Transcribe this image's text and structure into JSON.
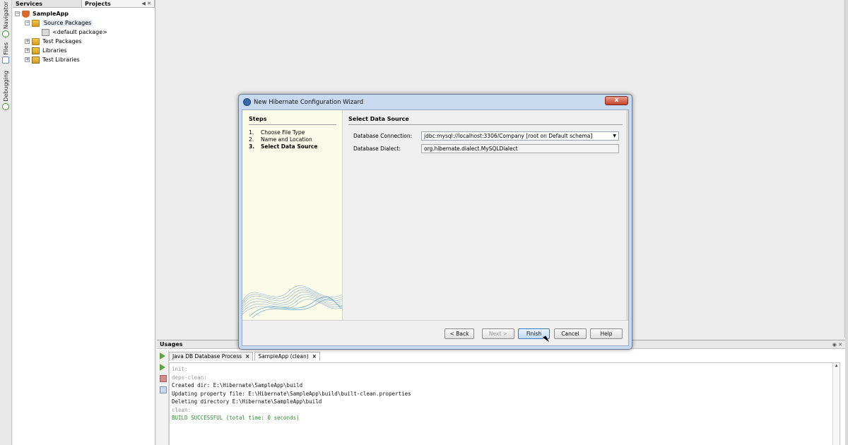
{
  "left_strip": {
    "tabs": [
      "Navigator",
      "Files",
      "Debugging"
    ]
  },
  "projects_panel": {
    "tabs": [
      "Services",
      "Projects"
    ],
    "tree": [
      {
        "label": "SampleApp",
        "level": 0,
        "toggle": "−",
        "bold": true,
        "icon": "project-icon"
      },
      {
        "label": "Source Packages",
        "level": 1,
        "toggle": "−",
        "icon": "source-packages-icon",
        "selected": true
      },
      {
        "label": "<default package>",
        "level": 2,
        "toggle": "",
        "icon": "package-icon"
      },
      {
        "label": "Test Packages",
        "level": 1,
        "toggle": "+",
        "icon": "test-packages-icon"
      },
      {
        "label": "Libraries",
        "level": 1,
        "toggle": "+",
        "icon": "libraries-icon"
      },
      {
        "label": "Test Libraries",
        "level": 1,
        "toggle": "+",
        "icon": "test-libraries-icon"
      }
    ]
  },
  "dialog": {
    "title": "New Hibernate Configuration Wizard",
    "close": "x",
    "steps_title": "Steps",
    "steps": [
      {
        "num": "1.",
        "label": "Choose File Type",
        "current": false
      },
      {
        "num": "2.",
        "label": "Name and Location",
        "current": false
      },
      {
        "num": "3.",
        "label": "Select Data Source",
        "current": true
      }
    ],
    "panel_title": "Select Data Source",
    "fields": {
      "connection_label": "Database Connection:",
      "connection_value": "jdbc:mysql://localhost:3306/Company [root on Default schema]",
      "dialect_label": "Database Dialect:",
      "dialect_value": "org.hibernate.dialect.MySQLDialect"
    },
    "buttons": {
      "back": "< Back",
      "next": "Next >",
      "finish": "Finish",
      "cancel": "Cancel",
      "help": "Help"
    }
  },
  "usages": {
    "title": "Usages",
    "tabs": [
      {
        "label": "Java DB Database Process",
        "active": false
      },
      {
        "label": "SampleApp (clean)",
        "active": true
      }
    ],
    "console": [
      {
        "text": "init:",
        "style": "muted"
      },
      {
        "text": "deps-clean:",
        "style": "muted"
      },
      {
        "text": "Created dir: E:\\Hibernate\\SampleApp\\build",
        "style": "normal"
      },
      {
        "text": "Updating property file: E:\\Hibernate\\SampleApp\\build\\built-clean.properties",
        "style": "normal"
      },
      {
        "text": "Deleting directory E:\\Hibernate\\SampleApp\\build",
        "style": "normal"
      },
      {
        "text": "clean:",
        "style": "muted"
      },
      {
        "text": "BUILD SUCCESSFUL (total time: 0 seconds)",
        "style": "ok"
      }
    ]
  }
}
